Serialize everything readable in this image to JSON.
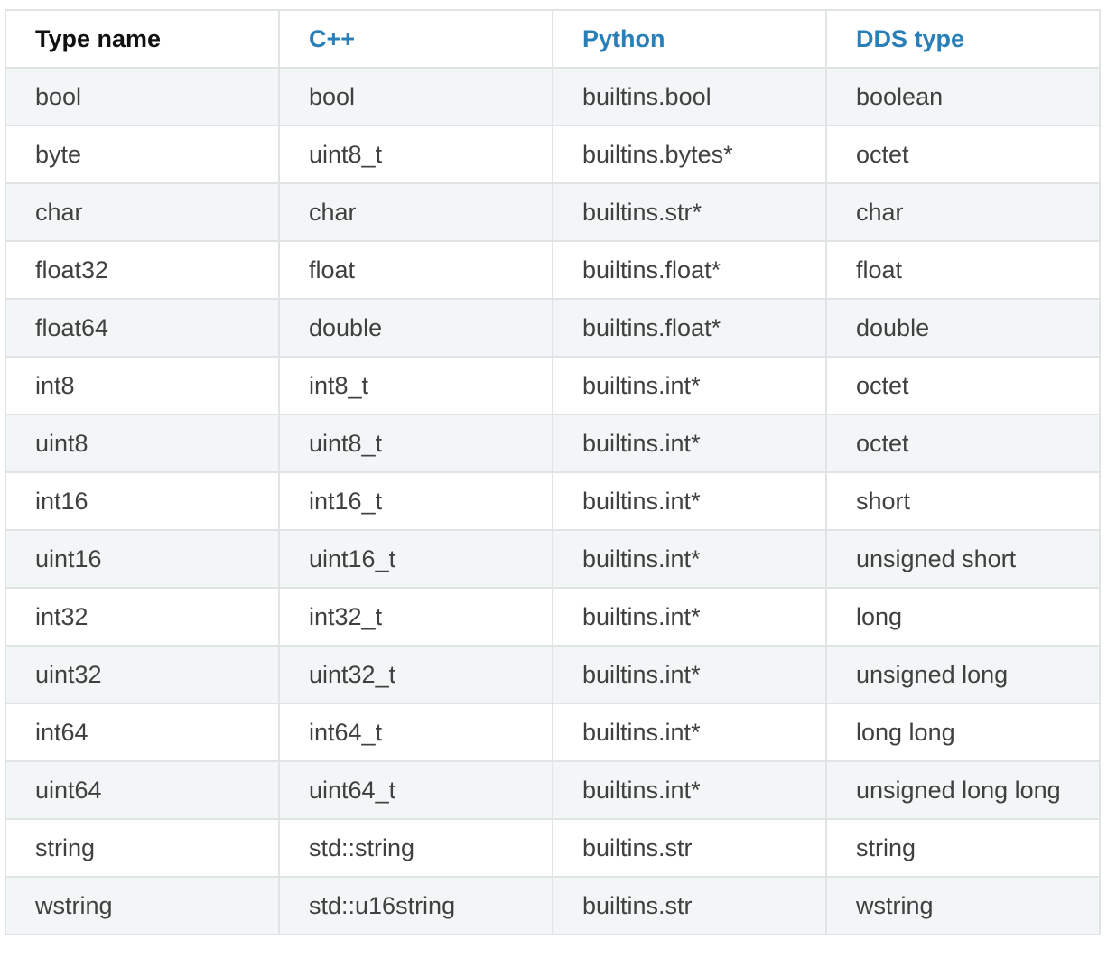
{
  "colors": {
    "header_link": "#2980b9",
    "header_plain": "#111111",
    "cell_text": "#404040",
    "row_stripe": "#f3f6f6",
    "border": "#e1e4e5"
  },
  "table": {
    "headers": [
      "Type name",
      "C++",
      "Python",
      "DDS type"
    ],
    "rows": [
      [
        "bool",
        "bool",
        "builtins.bool",
        "boolean"
      ],
      [
        "byte",
        "uint8_t",
        "builtins.bytes*",
        "octet"
      ],
      [
        "char",
        "char",
        "builtins.str*",
        "char"
      ],
      [
        "float32",
        "float",
        "builtins.float*",
        "float"
      ],
      [
        "float64",
        "double",
        "builtins.float*",
        "double"
      ],
      [
        "int8",
        "int8_t",
        "builtins.int*",
        "octet"
      ],
      [
        "uint8",
        "uint8_t",
        "builtins.int*",
        "octet"
      ],
      [
        "int16",
        "int16_t",
        "builtins.int*",
        "short"
      ],
      [
        "uint16",
        "uint16_t",
        "builtins.int*",
        "unsigned short"
      ],
      [
        "int32",
        "int32_t",
        "builtins.int*",
        "long"
      ],
      [
        "uint32",
        "uint32_t",
        "builtins.int*",
        "unsigned long"
      ],
      [
        "int64",
        "int64_t",
        "builtins.int*",
        "long long"
      ],
      [
        "uint64",
        "uint64_t",
        "builtins.int*",
        "unsigned long long"
      ],
      [
        "string",
        "std::string",
        "builtins.str",
        "string"
      ],
      [
        "wstring",
        "std::u16string",
        "builtins.str",
        "wstring"
      ]
    ]
  }
}
